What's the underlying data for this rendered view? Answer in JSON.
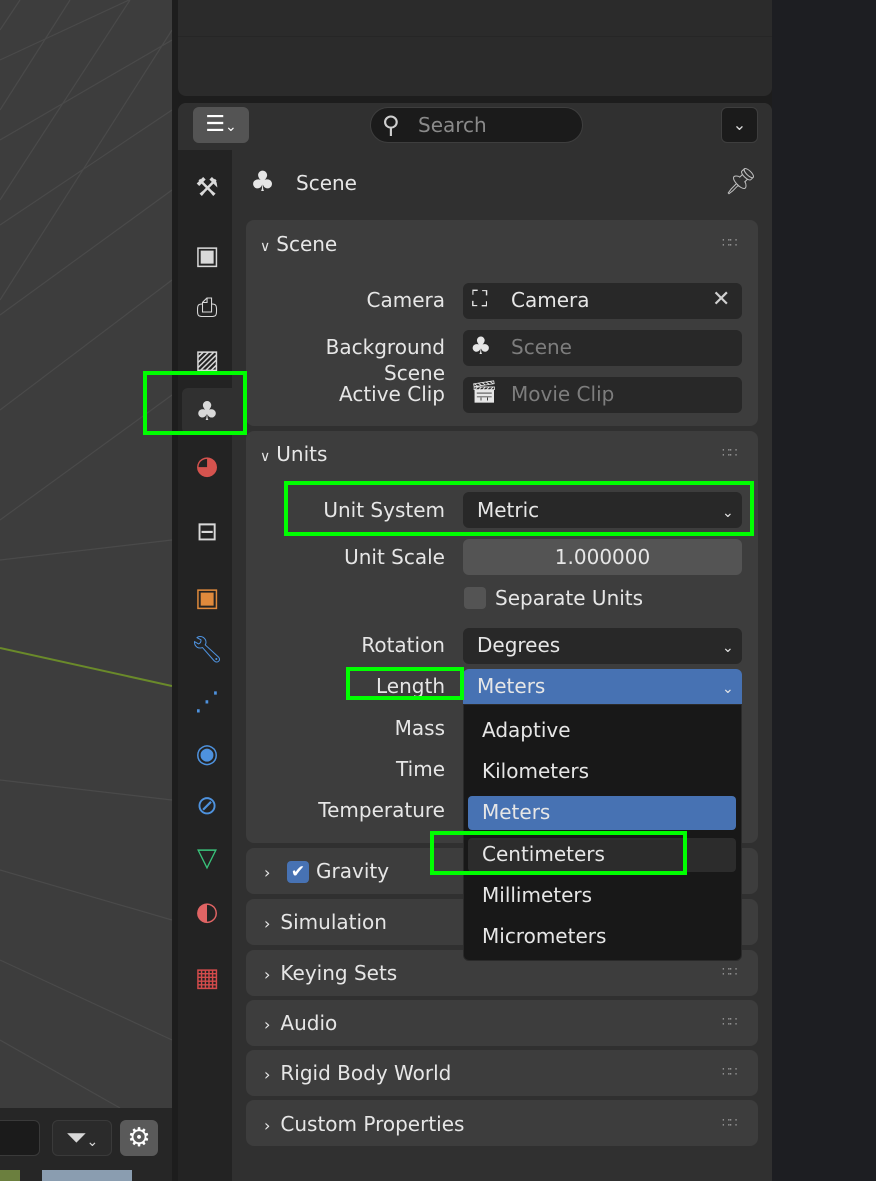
{
  "header": {
    "editor_type_icon": "properties-editor-icon",
    "search_placeholder": "Search",
    "options_icon": "chevron-down-icon"
  },
  "tabs": [
    {
      "name": "tool",
      "icon": "tool-icon",
      "color": "#d9d9d9"
    },
    {
      "name": "render",
      "icon": "camera-back-icon",
      "color": "#d9d9d9"
    },
    {
      "name": "output",
      "icon": "printer-icon",
      "color": "#d9d9d9"
    },
    {
      "name": "view-layer",
      "icon": "image-icon",
      "color": "#d9d9d9"
    },
    {
      "name": "scene",
      "icon": "scene-icon",
      "color": "#d9d9d9",
      "active": true
    },
    {
      "name": "world",
      "icon": "world-icon",
      "color": "#d5534e"
    },
    {
      "name": "collection",
      "icon": "collection-box-icon",
      "color": "#d9d9d9"
    },
    {
      "name": "object",
      "icon": "object-icon",
      "color": "#e08a3c"
    },
    {
      "name": "modifiers",
      "icon": "wrench-icon",
      "color": "#4e92de"
    },
    {
      "name": "particles",
      "icon": "particles-icon",
      "color": "#4e92de"
    },
    {
      "name": "physics",
      "icon": "physics-icon",
      "color": "#4e92de"
    },
    {
      "name": "constraints",
      "icon": "constraint-icon",
      "color": "#4e92de"
    },
    {
      "name": "data",
      "icon": "mesh-data-icon",
      "color": "#39c27a"
    },
    {
      "name": "material",
      "icon": "material-icon",
      "color": "#e06464"
    },
    {
      "name": "texture",
      "icon": "texture-icon",
      "color": "#d44b4b"
    }
  ],
  "context": {
    "label": "Scene"
  },
  "scene_panel": {
    "title": "Scene",
    "camera_label": "Camera",
    "camera_value": "Camera",
    "background_label": "Background Scene",
    "background_value": "Scene",
    "clip_label": "Active Clip",
    "clip_value": "Movie Clip"
  },
  "units_panel": {
    "title": "Units",
    "unit_system_label": "Unit System",
    "unit_system_value": "Metric",
    "unit_scale_label": "Unit Scale",
    "unit_scale_value": "1.000000",
    "separate_units_label": "Separate Units",
    "rotation_label": "Rotation",
    "rotation_value": "Degrees",
    "length_label": "Length",
    "length_value": "Meters",
    "mass_label": "Mass",
    "time_label": "Time",
    "temperature_label": "Temperature"
  },
  "length_menu": {
    "items": [
      "Adaptive",
      "Kilometers",
      "Meters",
      "Centimeters",
      "Millimeters",
      "Micrometers"
    ],
    "selected": "Meters",
    "hovered": "Centimeters"
  },
  "collapsed_panels": {
    "gravity": "Gravity",
    "simulation": "Simulation",
    "keying_sets": "Keying Sets",
    "audio": "Audio",
    "rigid_body": "Rigid Body World",
    "custom_props": "Custom Properties"
  },
  "colors": {
    "accent": "#4772b3",
    "highlight_box": "#00ff00",
    "checkbox_on": "#4772b3"
  }
}
